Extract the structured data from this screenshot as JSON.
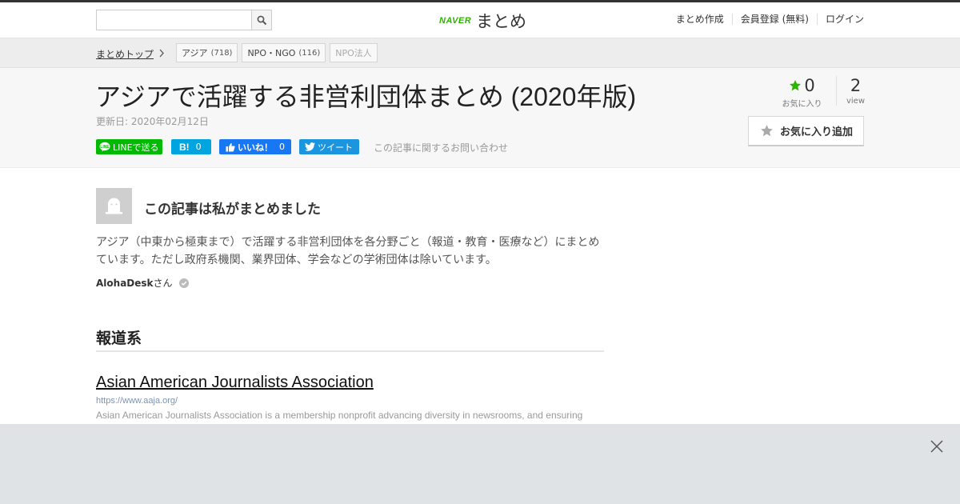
{
  "header": {
    "search": {
      "placeholder": "",
      "value": ""
    },
    "logo": {
      "brand": "NAVER",
      "product": "まとめ"
    },
    "nav": [
      "まとめ作成",
      "会員登録 (無料)",
      "ログイン"
    ]
  },
  "breadcrumb": {
    "home": "まとめトップ",
    "tags": [
      {
        "label": "アジア",
        "count": "(718)"
      },
      {
        "label": "NPO・NGO",
        "count": "(116)"
      },
      {
        "label": "NPO法人",
        "count": ""
      }
    ]
  },
  "article": {
    "title": "アジアで活躍する非営利団体まとめ (2020年版)",
    "updated": "更新日: 2020年02月12日",
    "share": {
      "line": "LINEで送る",
      "hatena_count": "0",
      "like": "いいね！",
      "like_count": "0",
      "tweet": "ツイート"
    },
    "contact": "この記事に関するお問い合わせ",
    "stats": {
      "favorites": "0",
      "favorites_label": "お気に入り",
      "views": "2",
      "views_label": "view"
    },
    "favorite_button": "お気に入り追加"
  },
  "author": {
    "heading": "この記事は私がまとめました",
    "description": "アジア（中東から極東まで）で活躍する非営利団体を各分野ごと（報道・教育・医療など）にまとめています。ただし政府系機関、業界団体、学会などの学術団体は除いています。",
    "name": "AlohaDesk",
    "suffix": "さん"
  },
  "content": {
    "section_heading": "報道系",
    "link": {
      "title": "Asian American Journalists Association",
      "url": "https://www.aaja.org/",
      "description": "Asian American Journalists Association is a membership nonprofit advancing diversity in newsrooms, and ensuring"
    }
  },
  "colors": {
    "brand_green": "#2db400",
    "line_green": "#00b900",
    "hatena_blue": "#00a4de",
    "facebook_blue": "#1877f2",
    "twitter_blue": "#1b95e0",
    "ad_overlay": "#dfe3e6"
  },
  "icons": [
    "search-icon",
    "chevron-right-icon",
    "line-icon",
    "hatena-icon",
    "facebook-like-icon",
    "twitter-icon",
    "star-icon",
    "avatar-icon",
    "verified-check-icon",
    "close-icon"
  ]
}
